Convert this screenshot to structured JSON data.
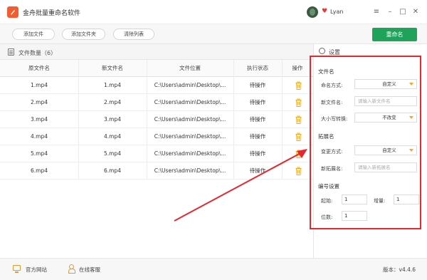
{
  "app": {
    "title": "金舟批量重命名软件",
    "user_name": "Lyan"
  },
  "window_controls": {
    "menu": "≡",
    "minimize": "–",
    "maximize": "□",
    "close": "✕"
  },
  "toolbar": {
    "add_file": "添加文件",
    "add_folder": "添加文件夹",
    "clear_list": "清除列表",
    "rename": "重命名"
  },
  "file_count": {
    "label": "文件数量（6）"
  },
  "table": {
    "headers": [
      "原文件名",
      "新文件名",
      "文件位置",
      "执行状态",
      "操作"
    ],
    "rows": [
      {
        "original": "1.mp4",
        "new": "1.mp4",
        "location": "C:\\Users\\admin\\Desktop\\...",
        "status": "待操作"
      },
      {
        "original": "2.mp4",
        "new": "2.mp4",
        "location": "C:\\Users\\admin\\Desktop\\...",
        "status": "待操作"
      },
      {
        "original": "3.mp4",
        "new": "3.mp4",
        "location": "C:\\Users\\admin\\Desktop\\...",
        "status": "待操作"
      },
      {
        "original": "4.mp4",
        "new": "4.mp4",
        "location": "C:\\Users\\admin\\Desktop\\...",
        "status": "待操作"
      },
      {
        "original": "5.mp4",
        "new": "5.mp4",
        "location": "C:\\Users\\admin\\Desktop\\...",
        "status": "待操作"
      },
      {
        "original": "6.mp4",
        "new": "6.mp4",
        "location": "C:\\Users\\admin\\Desktop\\...",
        "status": "待操作"
      }
    ]
  },
  "settings": {
    "title": "设置",
    "filename_section": "文件名",
    "naming_mode_label": "命名方式:",
    "naming_mode_value": "自定义",
    "new_name_label": "新文件名:",
    "new_name_placeholder": "请输入新文件名",
    "case_label": "大小写转换:",
    "case_value": "不改变",
    "ext_section": "拓展名",
    "change_mode_label": "变更方式:",
    "change_mode_value": "自定义",
    "new_ext_label": "新拓展名:",
    "new_ext_placeholder": "请输入新拓展名",
    "numbering_section": "编号设置",
    "start_label": "起始:",
    "start_value": "1",
    "increment_label": "增量:",
    "increment_value": "1",
    "digits_label": "位数:",
    "digits_value": "1"
  },
  "statusbar": {
    "website": "官方网站",
    "support": "在线客服",
    "version": "版本：v4.4.6"
  },
  "colors": {
    "accent_green": "#1fa35a",
    "highlight_red": "#e8262c",
    "icon_orange": "#f5a623"
  },
  "icons": [
    "app-logo-icon",
    "heart-icon",
    "doc-icon",
    "trash-icon",
    "gear-icon",
    "monitor-icon",
    "person-icon",
    "caret-down-icon"
  ]
}
